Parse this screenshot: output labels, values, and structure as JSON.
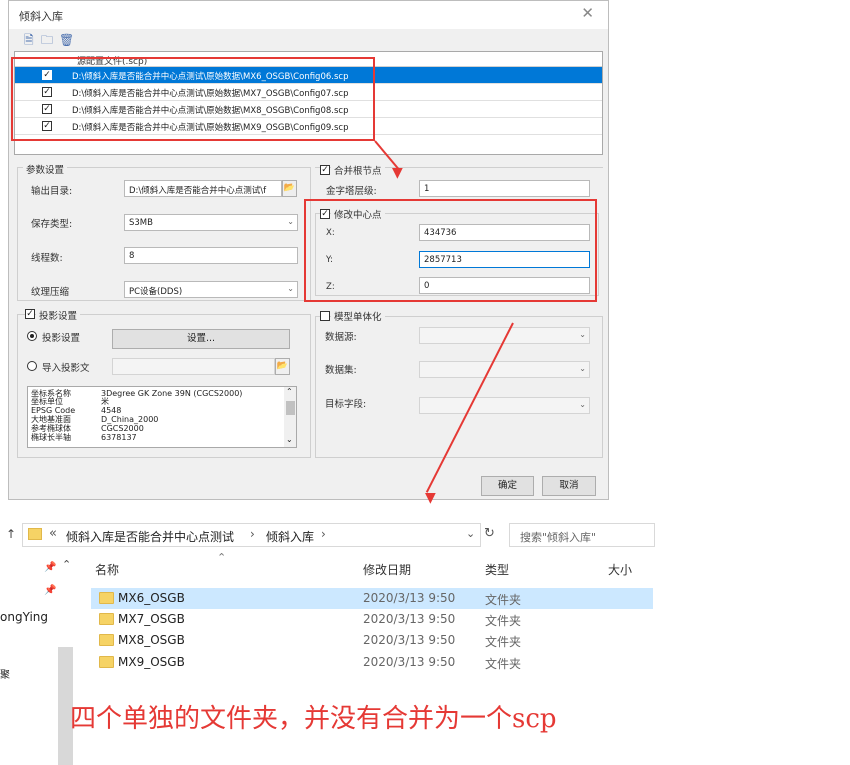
{
  "dialog": {
    "title": "倾斜入库",
    "close_glyph": "✕",
    "file_list": {
      "header": "源配置文件(.scp)",
      "rows": [
        {
          "checked": true,
          "path": "D:\\倾斜入库是否能合并中心点测试\\原始数据\\MX6_OSGB\\Config06.scp",
          "selected": true
        },
        {
          "checked": true,
          "path": "D:\\倾斜入库是否能合并中心点测试\\原始数据\\MX7_OSGB\\Config07.scp",
          "selected": false
        },
        {
          "checked": true,
          "path": "D:\\倾斜入库是否能合并中心点测试\\原始数据\\MX8_OSGB\\Config08.scp",
          "selected": false
        },
        {
          "checked": true,
          "path": "D:\\倾斜入库是否能合并中心点测试\\原始数据\\MX9_OSGB\\Config09.scp",
          "selected": false
        }
      ]
    },
    "params": {
      "title": "参数设置",
      "output_dir_label": "输出目录:",
      "output_dir_value": "D:\\倾斜入库是否能合并中心点测试\\f",
      "save_type_label": "保存类型:",
      "save_type_value": "S3MB",
      "threads_label": "线程数:",
      "threads_value": "8",
      "texture_label": "纹理压缩",
      "texture_value": "PC设备(DDS)"
    },
    "merge_root": {
      "label": "合并根节点",
      "checked": true,
      "pyramid_label": "金字塔层级:",
      "pyramid_value": "1"
    },
    "center": {
      "label": "修改中心点",
      "checked": true,
      "x_label": "X:",
      "x_value": "434736",
      "y_label": "Y:",
      "y_value": "2857713",
      "z_label": "Z:",
      "z_value": "0"
    },
    "projection": {
      "label": "投影设置",
      "checked": true,
      "option1": "投影设置",
      "settings_button": "设置...",
      "option2": "导入投影文",
      "info": [
        {
          "key": "坐标系名称",
          "value": "3Degree GK Zone 39N    (CGCS2000)"
        },
        {
          "key": "坐标单位",
          "value": "米"
        },
        {
          "key": "EPSG Code",
          "value": "4548"
        },
        {
          "key": "大地基准面",
          "value": "D_China_2000"
        },
        {
          "key": "参考椭球体",
          "value": "CGCS2000"
        },
        {
          "key": "椭球长半轴",
          "value": "6378137"
        }
      ]
    },
    "model": {
      "label": "模型单体化",
      "checked": false,
      "datasource_label": "数据源:",
      "dataset_label": "数据集:",
      "target_label": "目标字段:"
    },
    "ok_button": "确定",
    "cancel_button": "取消"
  },
  "explorer": {
    "breadcrumb": [
      "倾斜入库是否能合并中心点测试",
      "倾斜入库"
    ],
    "breadcrumb_sep": "›",
    "breadcrumb_prefix": "«",
    "search_placeholder": "搜索\"倾斜入库\"",
    "columns": {
      "name": "名称",
      "date": "修改日期",
      "type": "类型",
      "size": "大小"
    },
    "rows": [
      {
        "name": "MX6_OSGB",
        "date": "2020/3/13 9:50",
        "type": "文件夹",
        "selected": true
      },
      {
        "name": "MX7_OSGB",
        "date": "2020/3/13 9:50",
        "type": "文件夹",
        "selected": false
      },
      {
        "name": "MX8_OSGB",
        "date": "2020/3/13 9:50",
        "type": "文件夹",
        "selected": false
      },
      {
        "name": "MX9_OSGB",
        "date": "2020/3/13 9:50",
        "type": "文件夹",
        "selected": false
      }
    ],
    "left_pane_text": "ongYing",
    "left_pane_text2": "聚"
  },
  "annotation": {
    "caption": "四个单独的文件夹，并没有合并为一个scp",
    "color": "#e53935"
  },
  "colors": {
    "selection": "#0078d7",
    "explorer_selection": "#cce8ff",
    "folder": "#f6d365"
  }
}
